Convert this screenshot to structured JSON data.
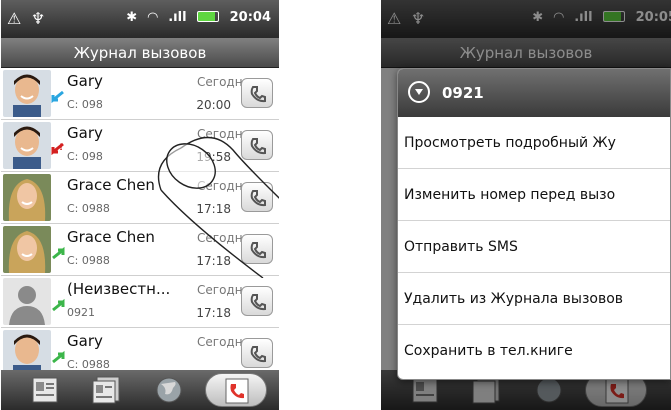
{
  "left": {
    "status": {
      "left_icons": "⚠ ♆",
      "time": "20:04"
    },
    "title": "Журнал вызовов",
    "rows": [
      {
        "name": "Gary",
        "number": "С: 098",
        "date": "Сегодня",
        "time": "20:00",
        "type": "incoming"
      },
      {
        "name": "Gary",
        "number": "С: 098",
        "date": "Сегодня",
        "time": "19:58",
        "type": "missed"
      },
      {
        "name": "Grace Chen",
        "number": "С: 0988",
        "date": "Сегодня",
        "time": "17:18",
        "type": "incoming"
      },
      {
        "name": "Grace Chen",
        "number": "С: 0988",
        "date": "Сегодня",
        "time": "17:18",
        "type": "outgoing"
      },
      {
        "name": "(Неизвестн...",
        "number": "0921",
        "date": "Сегодня",
        "time": "17:18",
        "type": "outgoing"
      },
      {
        "name": "Gary",
        "number": "С: 0988",
        "date": "Сегодня",
        "time": "",
        "type": "outgoing"
      }
    ],
    "tabs": [
      "contacts-tab",
      "groups-tab",
      "favorites-tab",
      "call-history-tab"
    ]
  },
  "right": {
    "status": {
      "left_icons": "⚠ ♆",
      "time": "20:05"
    },
    "title": "Журнал вызовов",
    "menu": {
      "header": "0921",
      "items": [
        "Просмотреть подробный Жу",
        "Изменить номер перед вызо",
        "Отправить SMS",
        "Удалить из Журнала вызовов",
        "Сохранить в тел.книге"
      ]
    }
  },
  "colors": {
    "status_bar": "#3a3a3a",
    "battery": "#5fd641",
    "call_icon": "#e0332b",
    "incoming_arrow": "#2aa6e0",
    "missed_arrow": "#d42020"
  }
}
